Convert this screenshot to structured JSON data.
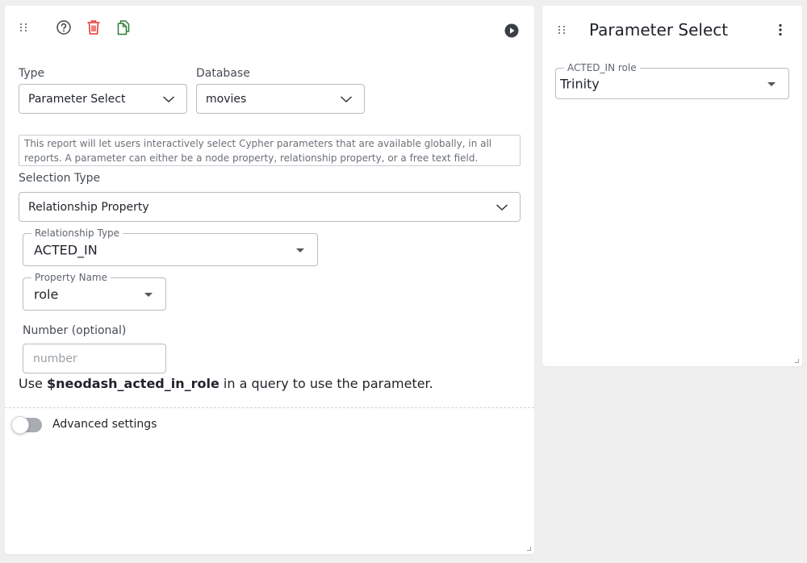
{
  "settings": {
    "type_label": "Type",
    "type_value": "Parameter Select",
    "database_label": "Database",
    "database_value": "movies",
    "description": "This report will let users interactively select Cypher parameters that are available globally, in all reports. A parameter can either be a node property, relationship property, or a free text field.",
    "selection_type_label": "Selection Type",
    "selection_type_value": "Relationship Property",
    "relationship_type_label": "Relationship Type",
    "relationship_type_value": "ACTED_IN",
    "property_name_label": "Property Name",
    "property_name_value": "role",
    "number_label": "Number (optional)",
    "number_placeholder": "number",
    "usage_prefix": "Use ",
    "usage_param": "$neodash_acted_in_role",
    "usage_suffix": " in a query to use the parameter.",
    "advanced_label": "Advanced settings",
    "advanced_enabled": false
  },
  "toolbar": {
    "icons": [
      "drag-handle-icon",
      "help-icon",
      "delete-icon",
      "copy-icon",
      "run-icon"
    ]
  },
  "preview": {
    "title": "Parameter Select",
    "field_label": "ACTED_IN role",
    "field_value": "Trinity"
  },
  "colors": {
    "delete": "#e53935",
    "copy": "#2e7d32",
    "run": "#3a3f45"
  }
}
